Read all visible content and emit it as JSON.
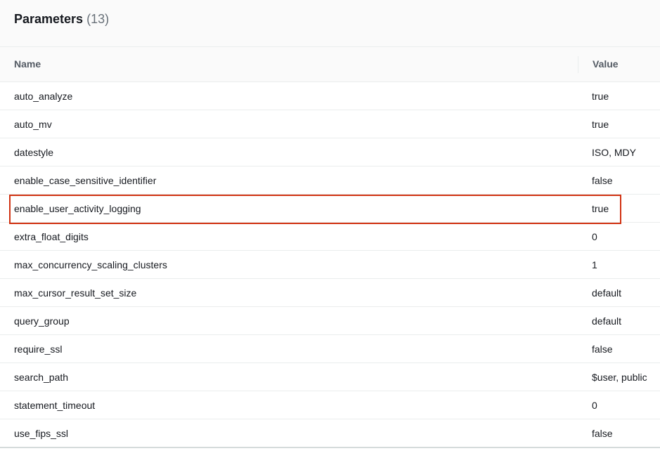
{
  "panel": {
    "title": "Parameters",
    "count": "(13)"
  },
  "table": {
    "columns": {
      "name": "Name",
      "value": "Value"
    },
    "rows": [
      {
        "name": "auto_analyze",
        "value": "true"
      },
      {
        "name": "auto_mv",
        "value": "true"
      },
      {
        "name": "datestyle",
        "value": "ISO, MDY"
      },
      {
        "name": "enable_case_sensitive_identifier",
        "value": "false"
      },
      {
        "name": "enable_user_activity_logging",
        "value": "true"
      },
      {
        "name": "extra_float_digits",
        "value": "0"
      },
      {
        "name": "max_concurrency_scaling_clusters",
        "value": "1"
      },
      {
        "name": "max_cursor_result_set_size",
        "value": "default"
      },
      {
        "name": "query_group",
        "value": "default"
      },
      {
        "name": "require_ssl",
        "value": "false"
      },
      {
        "name": "search_path",
        "value": "$user, public"
      },
      {
        "name": "statement_timeout",
        "value": "0"
      },
      {
        "name": "use_fips_ssl",
        "value": "false"
      }
    ],
    "highlighted_row": "enable_user_activity_logging"
  },
  "colors": {
    "highlight_border": "#d13212",
    "header_bg": "#fafafa",
    "divider": "#eaeded"
  }
}
